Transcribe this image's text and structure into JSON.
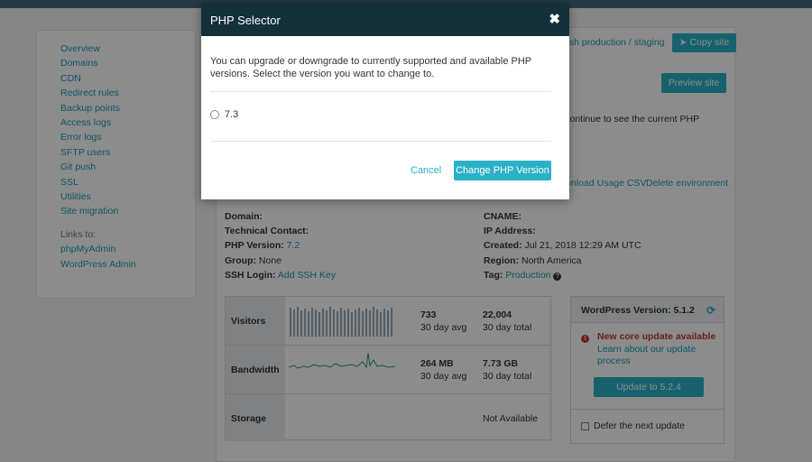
{
  "sidebar": {
    "items": [
      "Overview",
      "Domains",
      "CDN",
      "Redirect rules",
      "Backup points",
      "Access logs",
      "Error logs",
      "SFTP users",
      "Git push",
      "SSL",
      "Utilities",
      "Site migration"
    ],
    "links_title": "Links to:",
    "links": [
      "phpMyAdmin",
      "WordPress Admin"
    ]
  },
  "header": {
    "push_link": "Push production / staging",
    "copy_site": "Copy site",
    "preview_site": "Preview site",
    "php_notice": "...will continue to see the current PHP"
  },
  "actions": {
    "download_csv": "Download Usage CSV",
    "delete_environment": "Delete environment"
  },
  "info": {
    "domain_label": "Domain:",
    "technical_contact_label": "Technical Contact:",
    "php_version_label": "PHP Version:",
    "php_version_value": "7.2",
    "group_label": "Group:",
    "group_value": "None",
    "ssh_login_label": "SSH Login:",
    "ssh_login_value": "Add SSH Key",
    "cname_label": "CNAME:",
    "ip_address_label": "IP Address:",
    "created_label": "Created:",
    "created_value": "Jul 21, 2018 12:29 AM UTC",
    "region_label": "Region:",
    "region_value": "North America",
    "tag_label": "Tag:",
    "tag_value": "Production"
  },
  "stats": {
    "visitors_label": "Visitors",
    "visitors_avg": "733",
    "visitors_avg_sub": "30 day avg",
    "visitors_total": "22,004",
    "visitors_total_sub": "30 day total",
    "bandwidth_label": "Bandwidth",
    "bandwidth_avg": "264 MB",
    "bandwidth_avg_sub": "30 day avg",
    "bandwidth_total": "7.73 GB",
    "bandwidth_total_sub": "30 day total",
    "storage_label": "Storage",
    "storage_value": "Not Available"
  },
  "wordpress": {
    "title": "WordPress Version: 5.1.2",
    "update_alert": "New core update available",
    "learn_more": "Learn about our update process",
    "update_button": "Update to 5.2.4",
    "defer_label": "Defer the next update"
  },
  "modal": {
    "title": "PHP Selector",
    "close": "✖",
    "message": "You can upgrade or downgrade to currently supported and available PHP versions. Select the version you want to change to.",
    "option": "7.3",
    "cancel": "Cancel",
    "confirm": "Change PHP Version"
  },
  "colors": {
    "accent": "#2bb1c7",
    "modal_header": "#13303b",
    "alert": "#c0392b"
  }
}
